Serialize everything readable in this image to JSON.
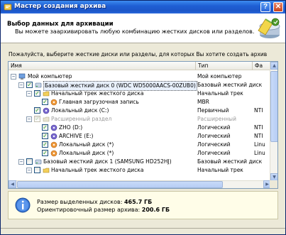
{
  "window": {
    "title": "Мастер создания архива",
    "help_label": "?",
    "close_label": "✕"
  },
  "header": {
    "title": "Выбор данных для архивации",
    "subtitle": "Вы можете заархивировать любую комбинацию жестких дисков или разделов."
  },
  "prompt": "Пожалуйста, выберите жесткие диски или разделы, для которых Вы хотите создать архив",
  "columns": [
    "Имя",
    "Тип",
    "Фа"
  ],
  "tree": [
    {
      "name": "Мой компьютер",
      "type": "Мой компьютер",
      "fs": "",
      "expander": "−",
      "checked": null,
      "icon": "computer-icon"
    },
    {
      "name": "Базовый жесткий диск 0 (WDC WD5000AACS-00ZUB0)",
      "type": "Базовый жесткий диск",
      "fs": "",
      "expander": "−",
      "checked": true,
      "icon": "hard-disk-icon"
    },
    {
      "name": "Начальный трек жесткого диска",
      "type": "Начальный трек",
      "fs": "",
      "expander": "−",
      "checked": true,
      "icon": "folder-icon"
    },
    {
      "name": "Главная загрузочная запись",
      "type": "MBR",
      "fs": "",
      "expander": "",
      "checked": true,
      "icon": "mbr-icon"
    },
    {
      "name": "Локальный диск (C:)",
      "type": "Первичный",
      "fs": "NTI",
      "expander": "",
      "checked": true,
      "icon": "partition-icon"
    },
    {
      "name": "Расширенный раздел",
      "type": "Расширенный",
      "fs": "",
      "expander": "−",
      "checked": true,
      "icon": "extended-partition-icon",
      "dim": true
    },
    {
      "name": "ZHO (D:)",
      "type": "Логический",
      "fs": "NTI",
      "expander": "",
      "checked": true,
      "icon": "partition-icon"
    },
    {
      "name": "ARCHIVE (E:)",
      "type": "Логический",
      "fs": "NTI",
      "expander": "",
      "checked": true,
      "icon": "partition-icon"
    },
    {
      "name": "Локальный диск (*)",
      "type": "Логический",
      "fs": "Linu",
      "expander": "",
      "checked": true,
      "icon": "partition-icon"
    },
    {
      "name": "Локальный диск (*)",
      "type": "Логический",
      "fs": "Linu",
      "expander": "",
      "checked": true,
      "icon": "partition-icon"
    },
    {
      "name": "Базовый жесткий диск 1 (SAMSUNG HD252HJ)",
      "type": "Базовый жесткий диск",
      "fs": "",
      "expander": "−",
      "checked": false,
      "icon": "hard-disk-icon"
    },
    {
      "name": "Начальный трек жесткого диска",
      "type": "Начальный трек",
      "fs": "",
      "expander": "−",
      "checked": false,
      "icon": "folder-icon"
    }
  ],
  "info": {
    "size_label": "Размер выделенных дисков:",
    "size_value": "465.7 ГБ",
    "archive_label": "Ориентировочный размер архива:",
    "archive_value": "200.6 ГБ"
  }
}
